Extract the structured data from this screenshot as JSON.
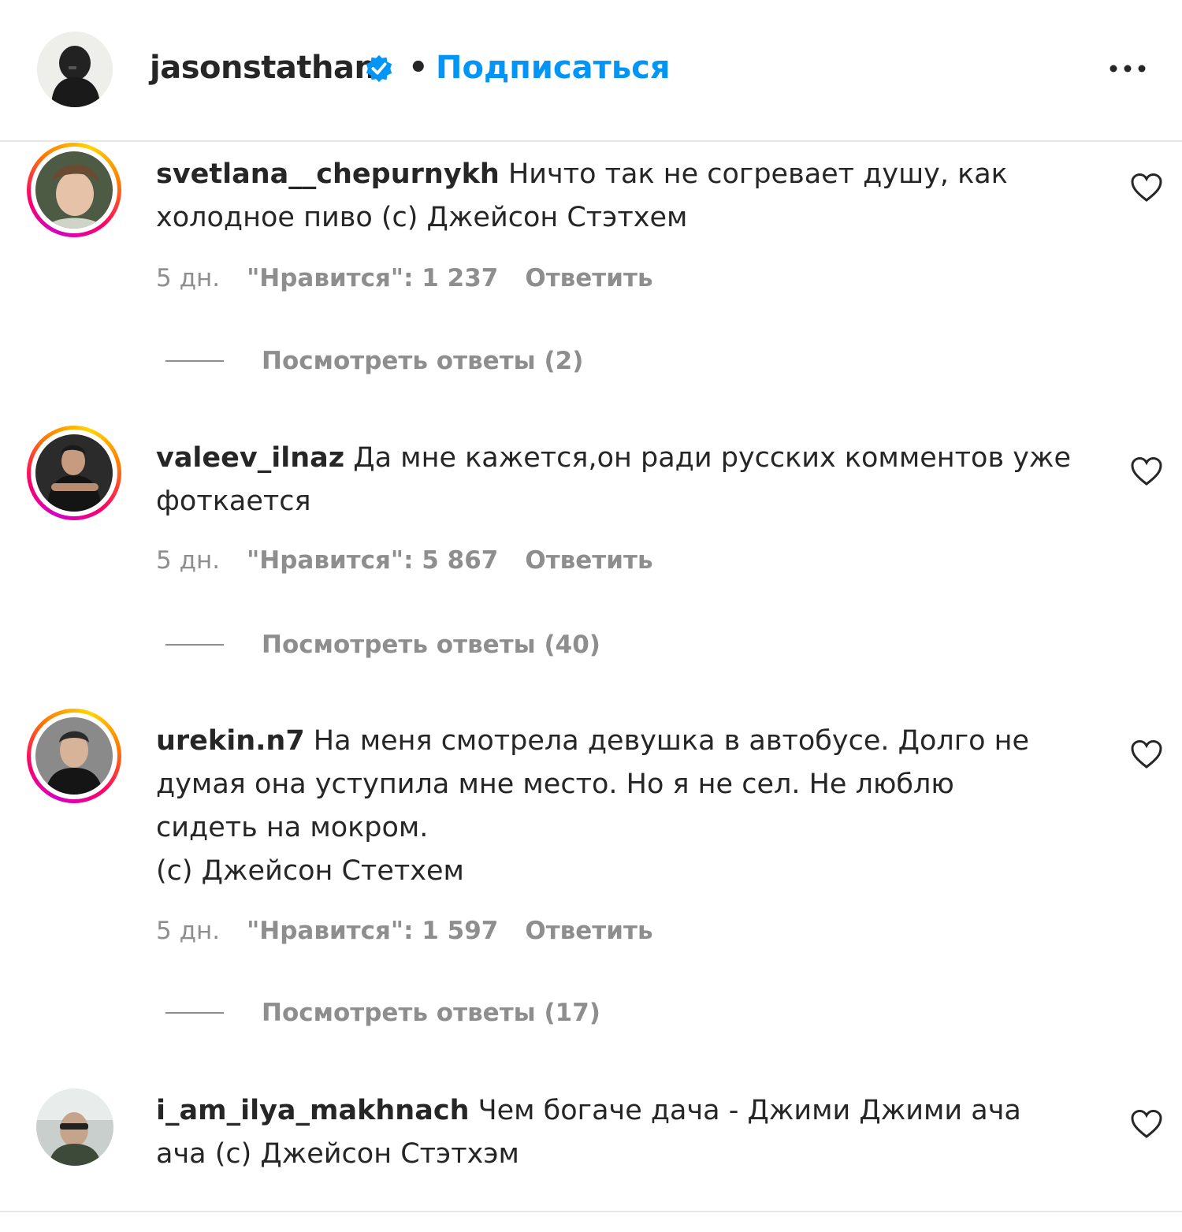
{
  "header": {
    "username": "jasonstatham",
    "separator": "•",
    "follow_label": "Подписаться"
  },
  "comments": [
    {
      "username": "svetlana__chepurnykh",
      "text": " Ничто так не согревает душу, как\nхолодное пиво (с) Джейсон Стэтхем",
      "time": "5 дн.",
      "likes": "\"Нравится\": 1 237",
      "reply_label": "Ответить",
      "view_replies": "Посмотреть ответы (2)",
      "has_story_ring": true
    },
    {
      "username": "valeev_ilnaz",
      "text": " Да мне кажется,он ради русских комментов уже\nфоткается",
      "time": "5 дн.",
      "likes": "\"Нравится\": 5 867",
      "reply_label": "Ответить",
      "view_replies": "Посмотреть ответы (40)",
      "has_story_ring": true
    },
    {
      "username": "urekin.n7",
      "text": " На меня смотрела девушка в автобусе. Долго не\nдумая она уступила мне место. Но я не сел. Не люблю\nсидеть на мокром.\n(с) Джейсон Стетхем",
      "time": "5 дн.",
      "likes": "\"Нравится\": 1 597",
      "reply_label": "Ответить",
      "view_replies": "Посмотреть ответы (17)",
      "has_story_ring": true
    },
    {
      "username": "i_am_ilya_makhnach",
      "text": " Чем богаче дача - Джими Джими ача\nача (с) Джейсон Стэтхэм",
      "has_story_ring": false
    }
  ],
  "colors": {
    "accent": "#0095f6",
    "text": "#262626",
    "muted": "#8e8e8e",
    "divider": "#e6e6e6"
  },
  "icons": {
    "verified": "verified-badge-icon",
    "more": "more-options-icon",
    "like": "heart-icon"
  }
}
